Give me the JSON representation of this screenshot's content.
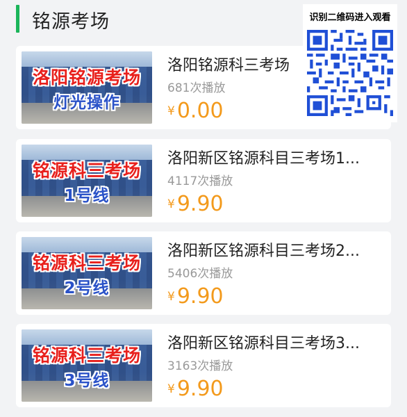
{
  "header": {
    "title": "铭源考场"
  },
  "qr": {
    "text": "识别二维码进入观看"
  },
  "videos": [
    {
      "thumb_line1": "洛阳铭源考场",
      "thumb_line2": "灯光操作",
      "title": "洛阳铭源科三考场",
      "plays": "681次播放",
      "currency": "¥",
      "price": "0.00"
    },
    {
      "thumb_line1": "铭源科三考场",
      "thumb_line2": "1号线",
      "title": "洛阳新区铭源科目三考场1...",
      "plays": "4117次播放",
      "currency": "¥",
      "price": "9.90"
    },
    {
      "thumb_line1": "铭源科三考场",
      "thumb_line2": "2号线",
      "title": "洛阳新区铭源科目三考场2...",
      "plays": "5406次播放",
      "currency": "¥",
      "price": "9.90"
    },
    {
      "thumb_line1": "铭源科三考场",
      "thumb_line2": "3号线",
      "title": "洛阳新区铭源科目三考场3...",
      "plays": "3163次播放",
      "currency": "¥",
      "price": "9.90"
    }
  ],
  "colors": {
    "accent": "#1bb55a",
    "price": "#f39a1c",
    "caption_red": "#e8201c",
    "caption_blue": "#2a52c8"
  }
}
